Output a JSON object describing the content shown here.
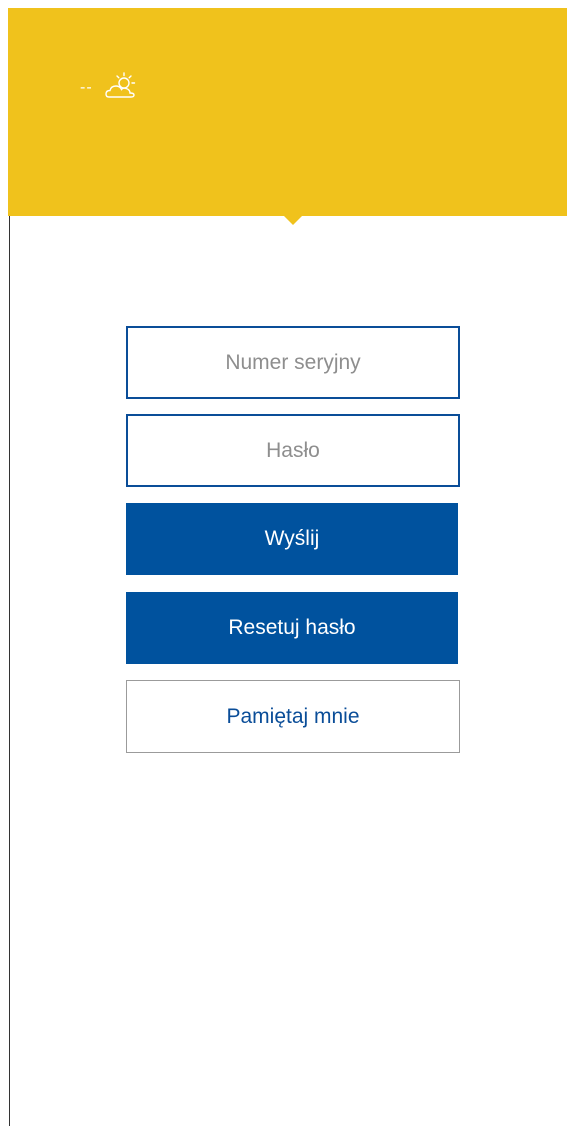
{
  "header": {
    "temperature": "--",
    "weather_icon": "partly-cloudy-icon",
    "background_color": "#f0c21c"
  },
  "login_form": {
    "serial_placeholder": "Numer seryjny",
    "password_placeholder": "Hasło",
    "submit_label": "Wyślij",
    "reset_label": "Resetuj hasło",
    "remember_label": "Pamiętaj mnie"
  },
  "colors": {
    "primary": "#00529e",
    "accent": "#f0c21c",
    "placeholder_text": "#8e8e8e"
  }
}
